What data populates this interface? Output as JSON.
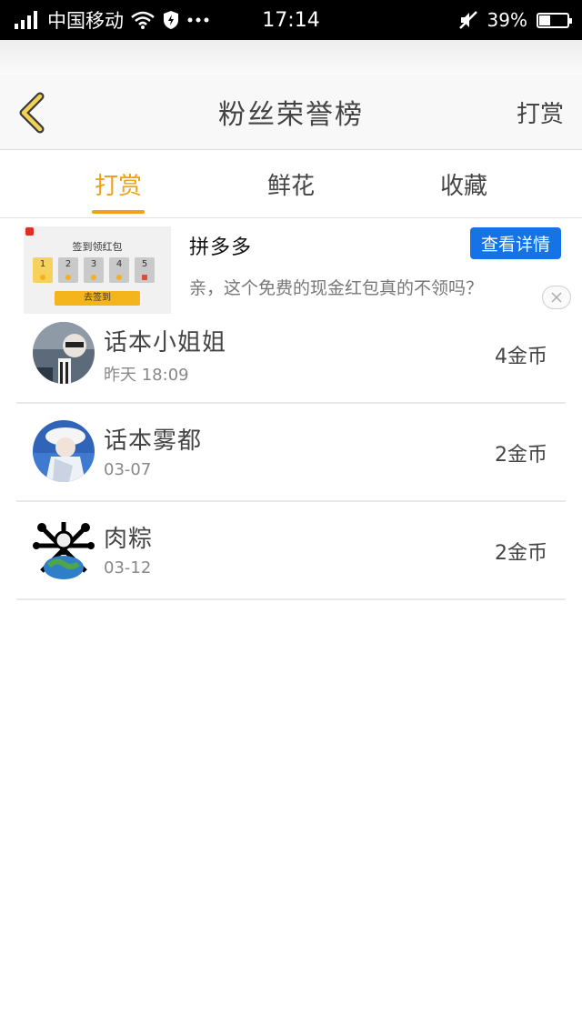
{
  "status_bar": {
    "carrier": "中国移动",
    "time": "17:14",
    "battery": "39%",
    "battery_level": 0.39
  },
  "nav": {
    "title": "粉丝荣誉榜",
    "right_action": "打赏"
  },
  "tabs": [
    {
      "label": "打赏",
      "active": true
    },
    {
      "label": "鲜花",
      "active": false
    },
    {
      "label": "收藏",
      "active": false
    }
  ],
  "ad": {
    "thumb_title": "签到领红包",
    "thumb_days": [
      "1",
      "2",
      "3",
      "4",
      "5"
    ],
    "thumb_button": "去签到",
    "name": "拼多多",
    "button": "查看详情",
    "description": "亲，这个免费的现金红包真的不领吗？"
  },
  "list": [
    {
      "name": "话本小姐姐",
      "time": "昨天 18:09",
      "amount": "4金币"
    },
    {
      "name": "话本雾都",
      "time": "03-07",
      "amount": "2金币"
    },
    {
      "name": "肉粽",
      "time": "03-12",
      "amount": "2金币"
    }
  ],
  "colors": {
    "accent": "#f0a01b",
    "ad_button": "#1573e6",
    "status_bar": "#000000"
  },
  "icons": [
    "signal-icon",
    "wifi-icon",
    "shield-icon",
    "more-dots-icon",
    "mute-icon",
    "battery-icon",
    "back-chevron-icon",
    "close-icon"
  ]
}
